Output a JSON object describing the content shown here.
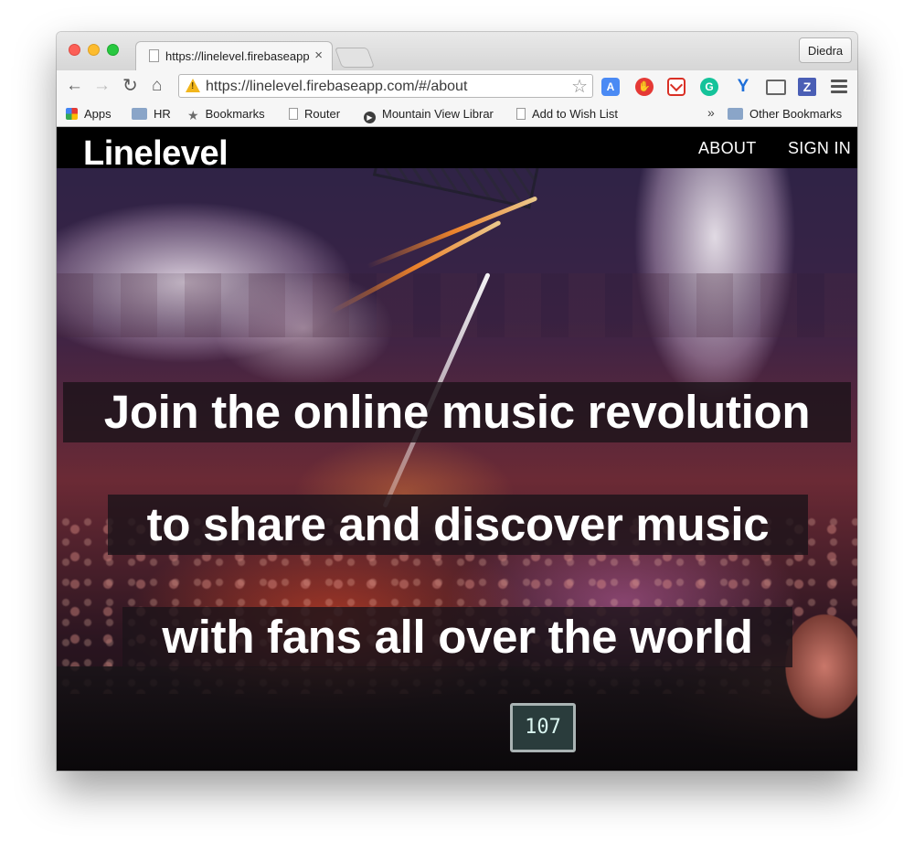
{
  "window": {
    "tab_title": "https://linelevel.firebaseapp.",
    "tab_close": "×",
    "profile_name": "Diedra"
  },
  "toolbar": {
    "url": "https://linelevel.firebaseapp.com/#/about",
    "back_icon": "←",
    "forward_icon": "→",
    "reload_icon": "↻",
    "home_icon": "⌂",
    "star_icon": "☆",
    "extensions": [
      "translate-icon",
      "hand-icon",
      "gmail-icon",
      "grammarly-icon",
      "y-icon",
      "cast-icon",
      "zotero-icon",
      "menu-icon"
    ]
  },
  "bookmarks": {
    "items": [
      {
        "label": "Apps",
        "icon": "apps-icon"
      },
      {
        "label": "HR",
        "icon": "folder-icon"
      },
      {
        "label": "Bookmarks",
        "icon": "star-icon"
      },
      {
        "label": "Router",
        "icon": "page-icon"
      },
      {
        "label": "Mountain View Librar",
        "icon": "play-icon"
      },
      {
        "label": "Add to Wish List",
        "icon": "page-icon"
      }
    ],
    "more": "»",
    "other": "Other Bookmarks"
  },
  "site": {
    "brand": "Linelevel",
    "nav": [
      "ABOUT",
      "SIGN IN"
    ],
    "headlines": [
      "Join the online music revolution",
      "to share and discover music",
      "with fans all over the world"
    ],
    "display_readout": "107"
  },
  "colors": {
    "header_bg": "#000000",
    "headline_bg": "#1c141a",
    "text": "#ffffff"
  }
}
